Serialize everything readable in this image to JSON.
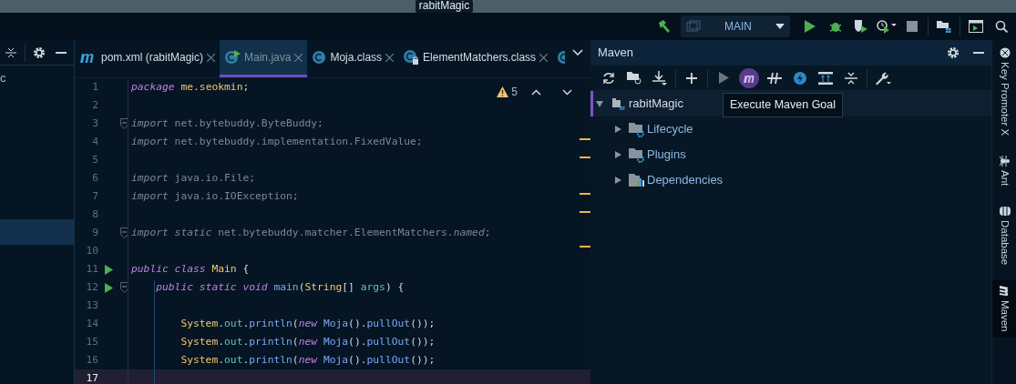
{
  "window": {
    "title": "rabitMagic"
  },
  "toolbar": {
    "run_configuration": "MAIN"
  },
  "left_panel": {
    "rows": [
      {
        "label": "c",
        "selected": false
      },
      {
        "selected": true
      }
    ]
  },
  "editor_tabs": [
    {
      "label": "pom.xml (rabitMagic)",
      "kind": "maven",
      "selected": false
    },
    {
      "label": "Main.java",
      "kind": "runnable",
      "selected": true
    },
    {
      "label": "Moja.class",
      "kind": "class",
      "selected": false
    },
    {
      "label": "ElementMatchers.class",
      "kind": "locked",
      "selected": false
    },
    {
      "kind": "class",
      "selected": false
    }
  ],
  "inspections": {
    "warnings": "5"
  },
  "code": {
    "lines": [
      {
        "number": "1",
        "run_marker": false,
        "fold": false,
        "current": false,
        "tokens": [
          {
            "text": "package ",
            "kind": "kw"
          },
          {
            "text": "me.seokmin",
            "kind": "type"
          },
          {
            "text": ";",
            "kind": "punct"
          }
        ]
      },
      {
        "number": "2",
        "run_marker": false,
        "fold": false,
        "current": false
      },
      {
        "number": "3",
        "run_marker": false,
        "fold": true,
        "current": false,
        "tokens": [
          {
            "text": "import",
            "kind": "dimkw"
          },
          {
            "text": " net.bytebuddy.ByteBuddy;",
            "kind": "dim"
          }
        ]
      },
      {
        "number": "4",
        "run_marker": false,
        "fold": false,
        "current": false,
        "tokens": [
          {
            "text": "import",
            "kind": "dimkw"
          },
          {
            "text": " net.bytebuddy.implementation.FixedValue;",
            "kind": "dim"
          }
        ]
      },
      {
        "number": "5",
        "run_marker": false,
        "fold": false,
        "current": false
      },
      {
        "number": "6",
        "run_marker": false,
        "fold": false,
        "current": false,
        "tokens": [
          {
            "text": "import",
            "kind": "dimkw"
          },
          {
            "text": " java.io.File;",
            "kind": "dim"
          }
        ]
      },
      {
        "number": "7",
        "run_marker": false,
        "fold": false,
        "current": false,
        "tokens": [
          {
            "text": "import",
            "kind": "dimkw"
          },
          {
            "text": " java.io.IOException;",
            "kind": "dim"
          }
        ]
      },
      {
        "number": "8",
        "run_marker": false,
        "fold": false,
        "current": false
      },
      {
        "number": "9",
        "run_marker": false,
        "fold": true,
        "current": false,
        "tokens": [
          {
            "text": "import static",
            "kind": "dimkw"
          },
          {
            "text": " net.bytebuddy.matcher.ElementMatchers.",
            "kind": "dim"
          },
          {
            "text": "named",
            "kind": "dimkw"
          },
          {
            "text": ";",
            "kind": "dim"
          }
        ]
      },
      {
        "number": "10",
        "run_marker": false,
        "fold": false,
        "current": false
      },
      {
        "number": "11",
        "run_marker": true,
        "fold": false,
        "current": false,
        "tokens": [
          {
            "text": "public class ",
            "kind": "kw"
          },
          {
            "text": "Main",
            "kind": "type"
          },
          {
            "text": " {",
            "kind": "punct"
          }
        ]
      },
      {
        "number": "12",
        "run_marker": true,
        "fold": true,
        "current": false,
        "tokens": [
          {
            "text": "    public static void ",
            "kind": "kw"
          },
          {
            "text": "main",
            "kind": "method"
          },
          {
            "text": "(",
            "kind": "punct"
          },
          {
            "text": "String",
            "kind": "type"
          },
          {
            "text": "[] ",
            "kind": "punct"
          },
          {
            "text": "args",
            "kind": "field"
          },
          {
            "text": ") {",
            "kind": "punct"
          }
        ]
      },
      {
        "number": "13",
        "run_marker": false,
        "fold": false,
        "current": false
      },
      {
        "number": "14",
        "run_marker": false,
        "fold": false,
        "current": false,
        "tokens": [
          {
            "text": "        System",
            "kind": "type"
          },
          {
            "text": ".",
            "kind": "punct"
          },
          {
            "text": "out",
            "kind": "field"
          },
          {
            "text": ".",
            "kind": "punct"
          },
          {
            "text": "println",
            "kind": "method"
          },
          {
            "text": "(",
            "kind": "punct"
          },
          {
            "text": "new ",
            "kind": "kw"
          },
          {
            "text": "Moja",
            "kind": "method"
          },
          {
            "text": "().",
            "kind": "punct"
          },
          {
            "text": "pullOut",
            "kind": "method"
          },
          {
            "text": "());",
            "kind": "punct"
          }
        ]
      },
      {
        "number": "15",
        "run_marker": false,
        "fold": false,
        "current": false,
        "tokens": [
          {
            "text": "        System",
            "kind": "type"
          },
          {
            "text": ".",
            "kind": "punct"
          },
          {
            "text": "out",
            "kind": "field"
          },
          {
            "text": ".",
            "kind": "punct"
          },
          {
            "text": "println",
            "kind": "method"
          },
          {
            "text": "(",
            "kind": "punct"
          },
          {
            "text": "new ",
            "kind": "kw"
          },
          {
            "text": "Moja",
            "kind": "method"
          },
          {
            "text": "().",
            "kind": "punct"
          },
          {
            "text": "pullOut",
            "kind": "method"
          },
          {
            "text": "());",
            "kind": "punct"
          }
        ]
      },
      {
        "number": "16",
        "run_marker": false,
        "fold": false,
        "current": false,
        "tokens": [
          {
            "text": "        System",
            "kind": "type"
          },
          {
            "text": ".",
            "kind": "punct"
          },
          {
            "text": "out",
            "kind": "field"
          },
          {
            "text": ".",
            "kind": "punct"
          },
          {
            "text": "println",
            "kind": "method"
          },
          {
            "text": "(",
            "kind": "punct"
          },
          {
            "text": "new ",
            "kind": "kw"
          },
          {
            "text": "Moja",
            "kind": "method"
          },
          {
            "text": "().",
            "kind": "punct"
          },
          {
            "text": "pullOut",
            "kind": "method"
          },
          {
            "text": "());",
            "kind": "punct"
          }
        ]
      },
      {
        "number": "17",
        "run_marker": false,
        "fold": false,
        "current": true
      }
    ]
  },
  "maven": {
    "title": "Maven",
    "tooltip": "Execute Maven Goal",
    "tree": [
      {
        "label": "rabitMagic",
        "kind": "project",
        "expanded": true,
        "selected": true,
        "children": [
          {
            "label": "Lifecycle",
            "kind": "settings",
            "expanded": false,
            "selected": false
          },
          {
            "label": "Plugins",
            "kind": "settings",
            "expanded": false,
            "selected": false
          },
          {
            "label": "Dependencies",
            "kind": "dependencies",
            "expanded": false,
            "selected": false
          }
        ]
      }
    ]
  },
  "right_strip": [
    {
      "label": "Key Promoter X",
      "kind": "promoter",
      "selected": false
    },
    {
      "label": "Ant",
      "kind": "ant",
      "selected": false
    },
    {
      "label": "Database",
      "kind": "database",
      "selected": false
    },
    {
      "label": "Maven",
      "kind": "maven",
      "selected": true
    }
  ]
}
